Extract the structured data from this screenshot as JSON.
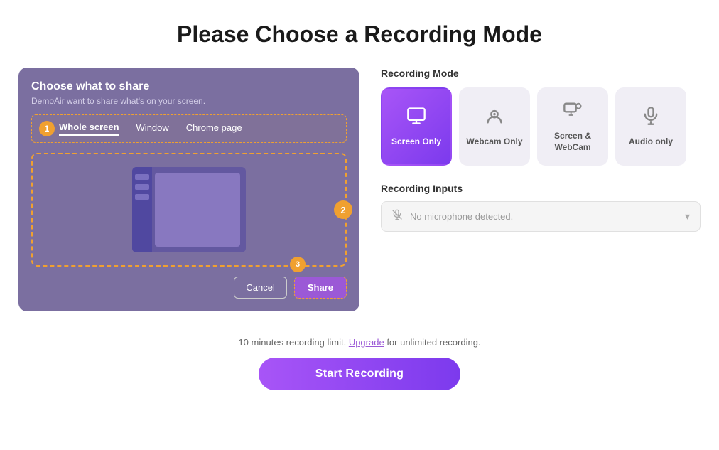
{
  "page": {
    "title": "Please Choose a Recording Mode"
  },
  "left_panel": {
    "title": "Choose what to share",
    "subtitle": "DemoAir want to share what's on your screen.",
    "step1_badge": "1",
    "step2_badge": "2",
    "step3_badge": "3",
    "tabs": [
      {
        "label": "Whole screen",
        "active": true
      },
      {
        "label": "Window",
        "active": false
      },
      {
        "label": "Chrome page",
        "active": false
      }
    ],
    "cancel_btn": "Cancel",
    "share_btn": "Share"
  },
  "right_panel": {
    "recording_mode_label": "Recording Mode",
    "modes": [
      {
        "id": "screen-only",
        "label": "Screen Only",
        "icon": "monitor",
        "active": true
      },
      {
        "id": "webcam-only",
        "label": "Webcam Only",
        "icon": "webcam",
        "active": false
      },
      {
        "id": "screen-webcam",
        "label": "Screen & WebCam",
        "icon": "screen-webcam",
        "active": false
      },
      {
        "id": "audio-only",
        "label": "Audio only",
        "icon": "microphone",
        "active": false
      }
    ],
    "recording_inputs_label": "Recording Inputs",
    "microphone_placeholder": "No microphone detected."
  },
  "bottom": {
    "limit_text_prefix": "10 minutes recording limit.",
    "upgrade_label": "Upgrade",
    "limit_text_suffix": "for unlimited recording.",
    "start_recording_btn": "Start Recording"
  }
}
